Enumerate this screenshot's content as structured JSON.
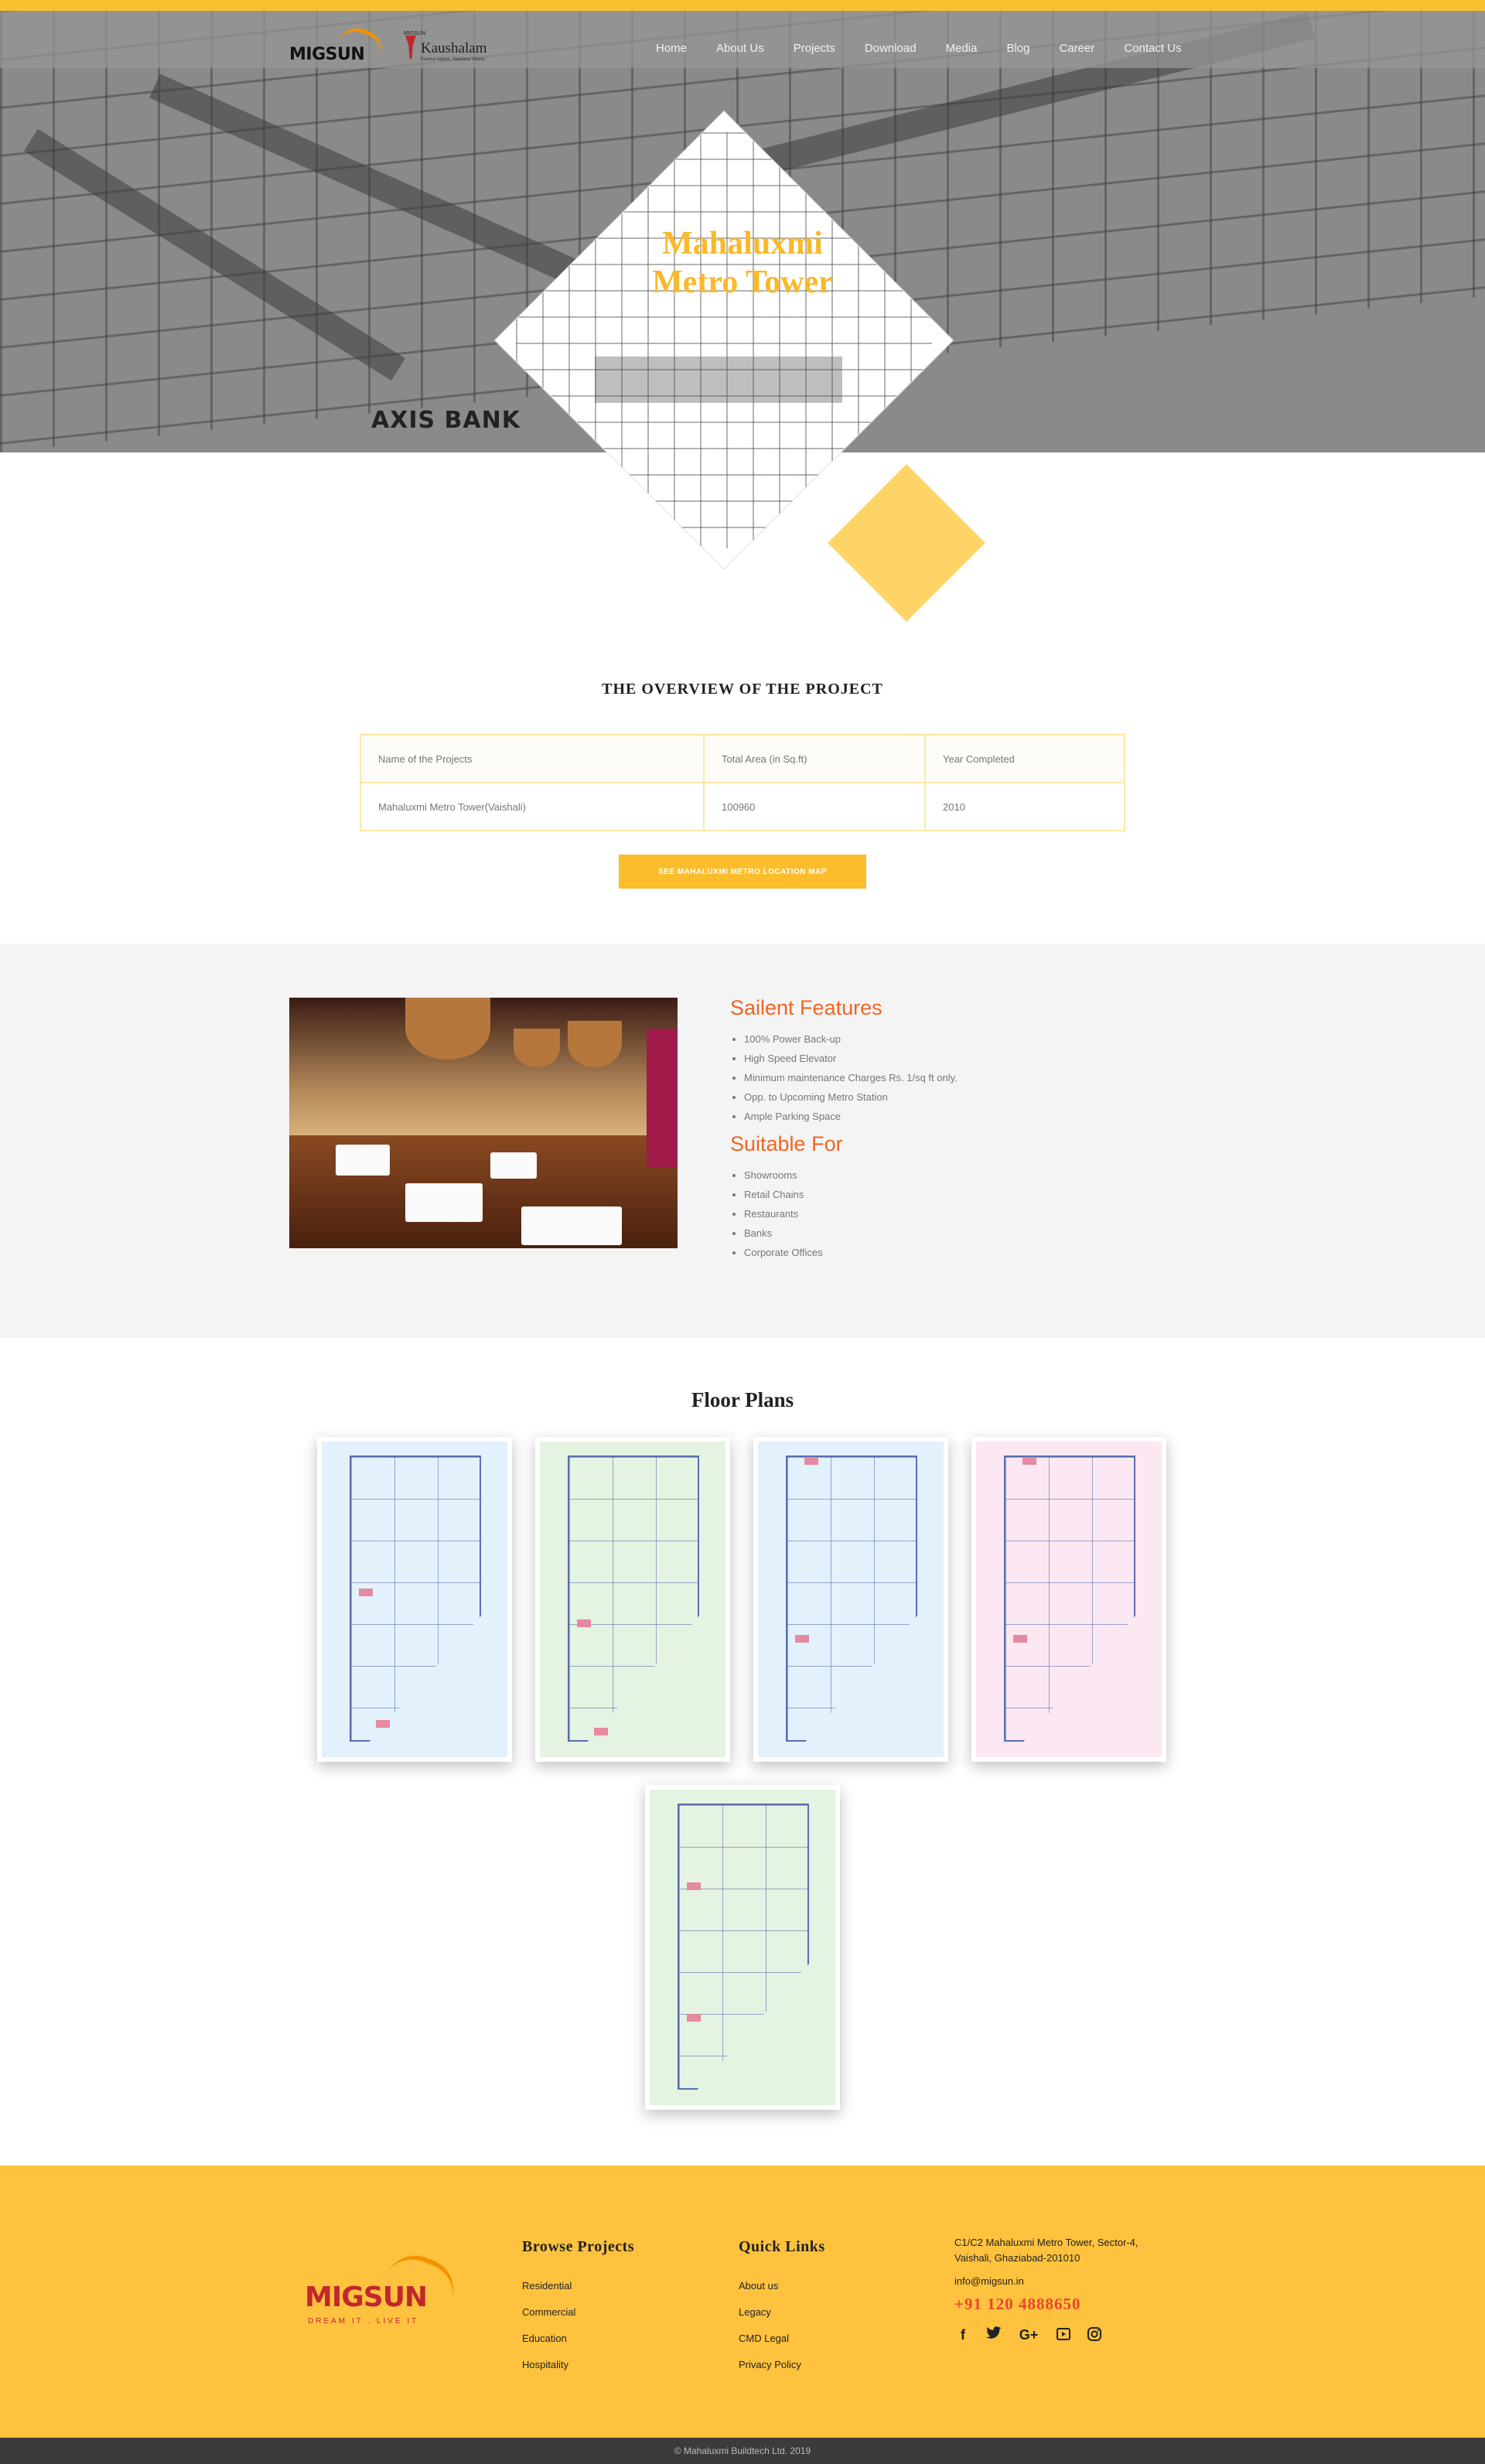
{
  "header": {
    "logo_text": "MIGSUN",
    "partner_logo_top": "MIGSUN",
    "partner_logo_name": "Kaushalam",
    "partner_logo_tag": "Kauma Vaasa, Vaahana Vaasa",
    "nav": [
      "Home",
      "About Us",
      "Projects",
      "Download",
      "Media",
      "Blog",
      "Career",
      "Contact Us"
    ]
  },
  "hero": {
    "title_line1": "Mahaluxmi",
    "title_line2": "Metro Tower",
    "sign_text": "AXIS BANK"
  },
  "overview": {
    "title": "THE OVERVIEW OF THE PROJECT",
    "headers": [
      "Name of the Projects",
      "Total Area (in Sq.ft)",
      "Year Completed"
    ],
    "row": [
      "Mahaluxmi Metro Tower(Vaishali)",
      "100960",
      "2010"
    ],
    "map_button": "SEE MAHALUXMI METRO LOCATION MAP"
  },
  "features": {
    "salient_heading": "Sailent Features",
    "salient_items": [
      "100% Power Back-up",
      "High Speed Elevator",
      "Minimum maintenance Charges Rs. 1/sq ft only.",
      "Opp. to Upcoming Metro Station",
      "Ample Parking Space"
    ],
    "suitable_heading": "Suitable For",
    "suitable_items": [
      "Showrooms",
      "Retail Chains",
      "Restaurants",
      "Banks",
      "Corporate Offices"
    ]
  },
  "floor_plans": {
    "title": "Floor Plans",
    "plans": [
      {
        "name": "floor-plan-1",
        "color": "#e3f1fc"
      },
      {
        "name": "floor-plan-2",
        "color": "#e5f3e2"
      },
      {
        "name": "floor-plan-3",
        "color": "#e3f1fc"
      },
      {
        "name": "floor-plan-4",
        "color": "#fbe8f2"
      },
      {
        "name": "floor-plan-5",
        "color": "#e5f3e2"
      }
    ]
  },
  "footer": {
    "logo_text": "MIGSUN",
    "slogan": "DREAM IT . LIVE IT",
    "browse_heading": "Browse Projects",
    "browse_links": [
      "Residential",
      "Commercial",
      "Education",
      "Hospitality"
    ],
    "quick_heading": "Quick Links",
    "quick_links": [
      "About us",
      "Legacy",
      "CMD Legal",
      "Privacy Policy"
    ],
    "address_line1": "C1/C2 Mahaluxmi Metro Tower, Sector-4,",
    "address_line2": "Vaishali, Ghaziabad-201010",
    "email": "info@migsun.in",
    "phone": "+91 120 4888650",
    "socials": [
      "facebook-icon",
      "twitter-icon",
      "google-plus-icon",
      "youtube-icon",
      "instagram-icon"
    ],
    "copyright": "© Mahaluxmi Buildtech Ltd. 2019"
  },
  "colors": {
    "accent": "#fbc02d",
    "brand_orange": "#f26522",
    "footer_bg": "#fec23f",
    "footer_bar": "#3b3b3b"
  }
}
